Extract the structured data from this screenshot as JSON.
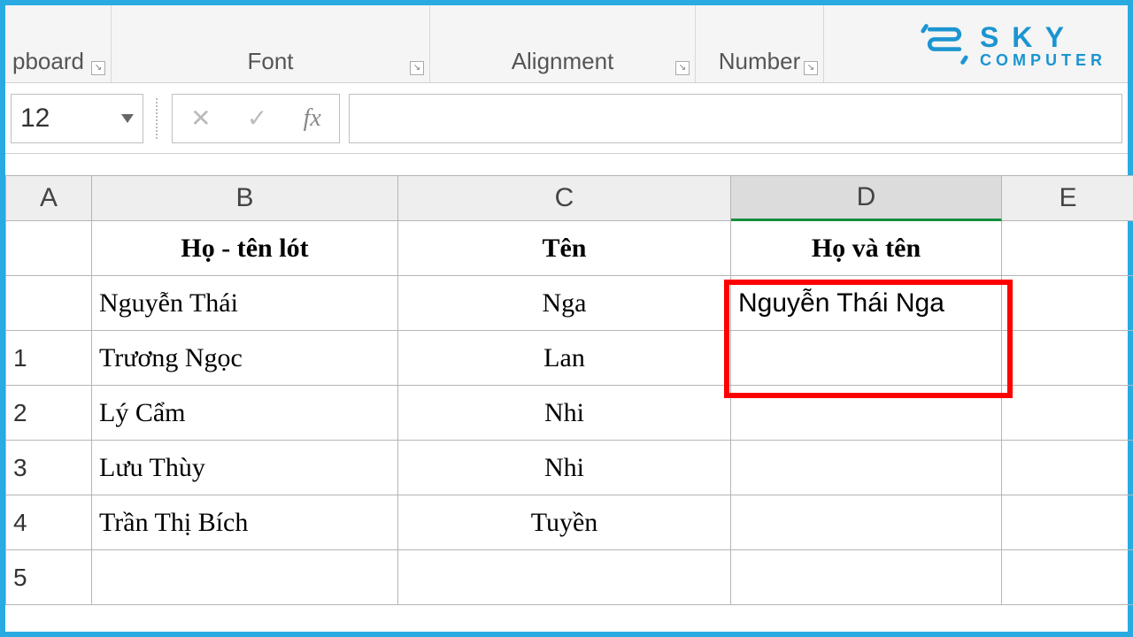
{
  "ribbon": {
    "clipboard": "pboard",
    "font": "Font",
    "alignment": "Alignment",
    "number": "Number"
  },
  "brand": {
    "line1": "S K Y",
    "line2": "COMPUTER"
  },
  "namebox": "12",
  "fx_label": "fx",
  "colHeaders": [
    "A",
    "B",
    "C",
    "D",
    "E"
  ],
  "rowHeaders": [
    "",
    "",
    "1",
    "2",
    "3",
    "4",
    "5"
  ],
  "table": {
    "header": {
      "b": "Họ - tên lót",
      "c": "Tên",
      "d": "Họ và tên"
    },
    "rows": [
      {
        "b": "Nguyễn   Thái",
        "c": "Nga",
        "d": "Nguyễn Thái Nga"
      },
      {
        "b": "Trương   Ngọc",
        "c": "Lan",
        "d": ""
      },
      {
        "b": "Lý   Cẩm",
        "c": "Nhi",
        "d": ""
      },
      {
        "b": "Lưu     Thùy",
        "c": "Nhi",
        "d": ""
      },
      {
        "b": "Trần  Thị   Bích",
        "c": "Tuyền",
        "d": ""
      },
      {
        "b": "",
        "c": "",
        "d": ""
      }
    ]
  }
}
